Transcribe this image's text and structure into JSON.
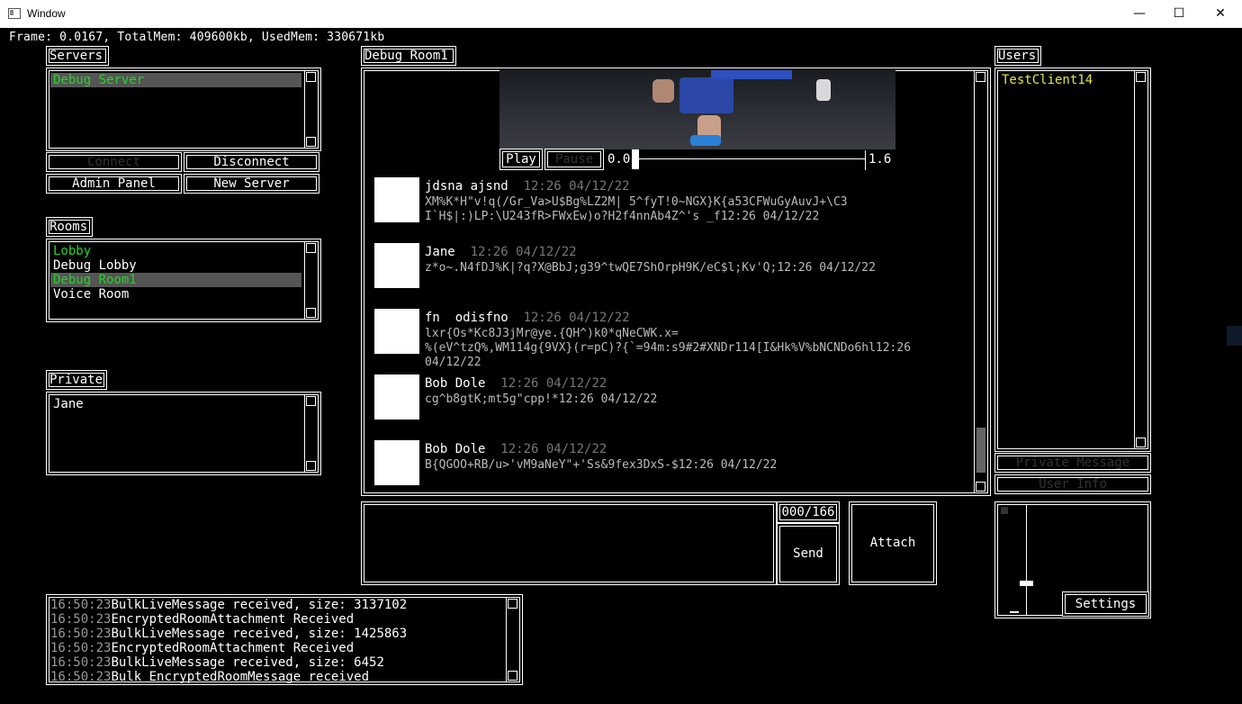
{
  "window": {
    "title": "Window",
    "minimize": "—",
    "maximize": "☐",
    "close": "✕"
  },
  "status_bar": "Frame: 0.0167, TotalMem: 409600kb, UsedMem: 330671kb",
  "servers": {
    "tab": "Servers",
    "items": [
      {
        "label": "Debug Server",
        "selected": true
      }
    ],
    "connect": "Connect",
    "disconnect": "Disconnect",
    "admin_panel": "Admin Panel",
    "new_server": "New Server"
  },
  "rooms": {
    "tab": "Rooms",
    "items": [
      {
        "label": "Lobby"
      },
      {
        "label": "Debug Lobby"
      },
      {
        "label": "Debug Room1"
      },
      {
        "label": "Voice Room"
      }
    ]
  },
  "private": {
    "tab": "Private",
    "items": [
      {
        "label": "Jane"
      }
    ]
  },
  "chat": {
    "tab": "Debug Room1",
    "video": {
      "play": "Play",
      "pause": "Pause",
      "start": "0.0",
      "end": "1.6",
      "progress": 0.0
    },
    "messages": [
      {
        "name": "jdsna ajsnd",
        "time": "12:26 04/12/22",
        "body": "XM%K*H\"v!q(/Gr_Va>U$Bg%LZ2M| 5^fyT!0~NGX}K{a53CFWuGyAuvJ+\\C3\nI`H$|:)LP:\\U243fR>FWxEw)o?H2f4nnAb4Z^'s _f12:26 04/12/22"
      },
      {
        "name": "Jane",
        "time": "12:26 04/12/22",
        "body": "z*o~.N4fDJ%K|?q?X@BbJ;g39^twQE7ShOrpH9K/eC$l;Kv'Q;12:26 04/12/22"
      },
      {
        "name": "fn  odisfno",
        "time": "12:26 04/12/22",
        "body": "lxr{Os*Kc8J3jMr@ye.{QH^)k0*qNeCWK.x=\n%(eV^tzQ%,WM114g{9VX}(r=pC)?{`=94m:s9#2#XNDr114[I&Hk%V%bNCNDo6hl12:26\n04/12/22"
      },
      {
        "name": "Bob Dole",
        "time": "12:26 04/12/22",
        "body": "cg^b8gtK;mt5g\"cpp!*12:26 04/12/22"
      },
      {
        "name": "Bob Dole",
        "time": "12:26 04/12/22",
        "body": "B{QGOO+RB/u>'vM9aNeY\"+'Ss&9fex3DxS-$12:26 04/12/22"
      }
    ]
  },
  "composer": {
    "counter": "000/166",
    "send": "Send",
    "attach": "Attach"
  },
  "users": {
    "tab": "Users",
    "items": [
      {
        "label": "TestClient14"
      }
    ],
    "private_message": "Private Message",
    "user_info": "User Info"
  },
  "audio": {
    "settings": "Settings",
    "volume": 0.28
  },
  "log": {
    "lines": [
      {
        "time": "16:50:23",
        "text": "BulkLiveMessage received, size: 3137102"
      },
      {
        "time": "16:50:23",
        "text": "EncryptedRoomAttachment Received"
      },
      {
        "time": "16:50:23",
        "text": "BulkLiveMessage received, size: 1425863"
      },
      {
        "time": "16:50:23",
        "text": "EncryptedRoomAttachment Received"
      },
      {
        "time": "16:50:23",
        "text": "BulkLiveMessage received, size: 6452"
      },
      {
        "time": "16:50:23",
        "text": "Bulk EncryptedRoomMessage received"
      }
    ]
  }
}
